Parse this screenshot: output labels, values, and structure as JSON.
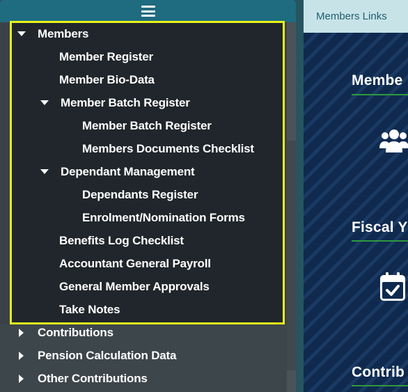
{
  "sidebar": {
    "toggle_icon": "hamburger-menu-icon",
    "members": {
      "label": "Members",
      "items": {
        "member_register": "Member Register",
        "member_bio_data": "Member Bio-Data",
        "member_batch_register_group": "Member Batch Register",
        "member_batch_register": "Member Batch Register",
        "members_documents_checklist": "Members Documents Checklist",
        "dependant_management_group": "Dependant Management",
        "dependants_register": "Dependants Register",
        "enrolment_nomination_forms": "Enrolment/Nomination Forms",
        "benefits_log_checklist": "Benefits Log Checklist",
        "accountant_general_payroll": "Accountant General Payroll",
        "general_member_approvals": "General Member Approvals",
        "take_notes": "Take Notes"
      }
    },
    "collapsed": {
      "contributions": "Contributions",
      "pension_calculation_data": "Pension Calculation Data",
      "other_contributions": "Other Contributions"
    }
  },
  "main": {
    "tab_label": "Members Links",
    "sections": {
      "members": "Membe",
      "fiscal": "Fiscal Y",
      "contributions": "Contrib"
    },
    "icons": {
      "users": "users-icon",
      "calendar": "calendar-check-icon"
    }
  },
  "colors": {
    "highlight_border": "#e7f21b",
    "header_bar": "#1f6b80",
    "tab_background": "#c8e3e8",
    "section_underline": "#2e9a3e",
    "stripe_background": "#0f2a4e"
  }
}
